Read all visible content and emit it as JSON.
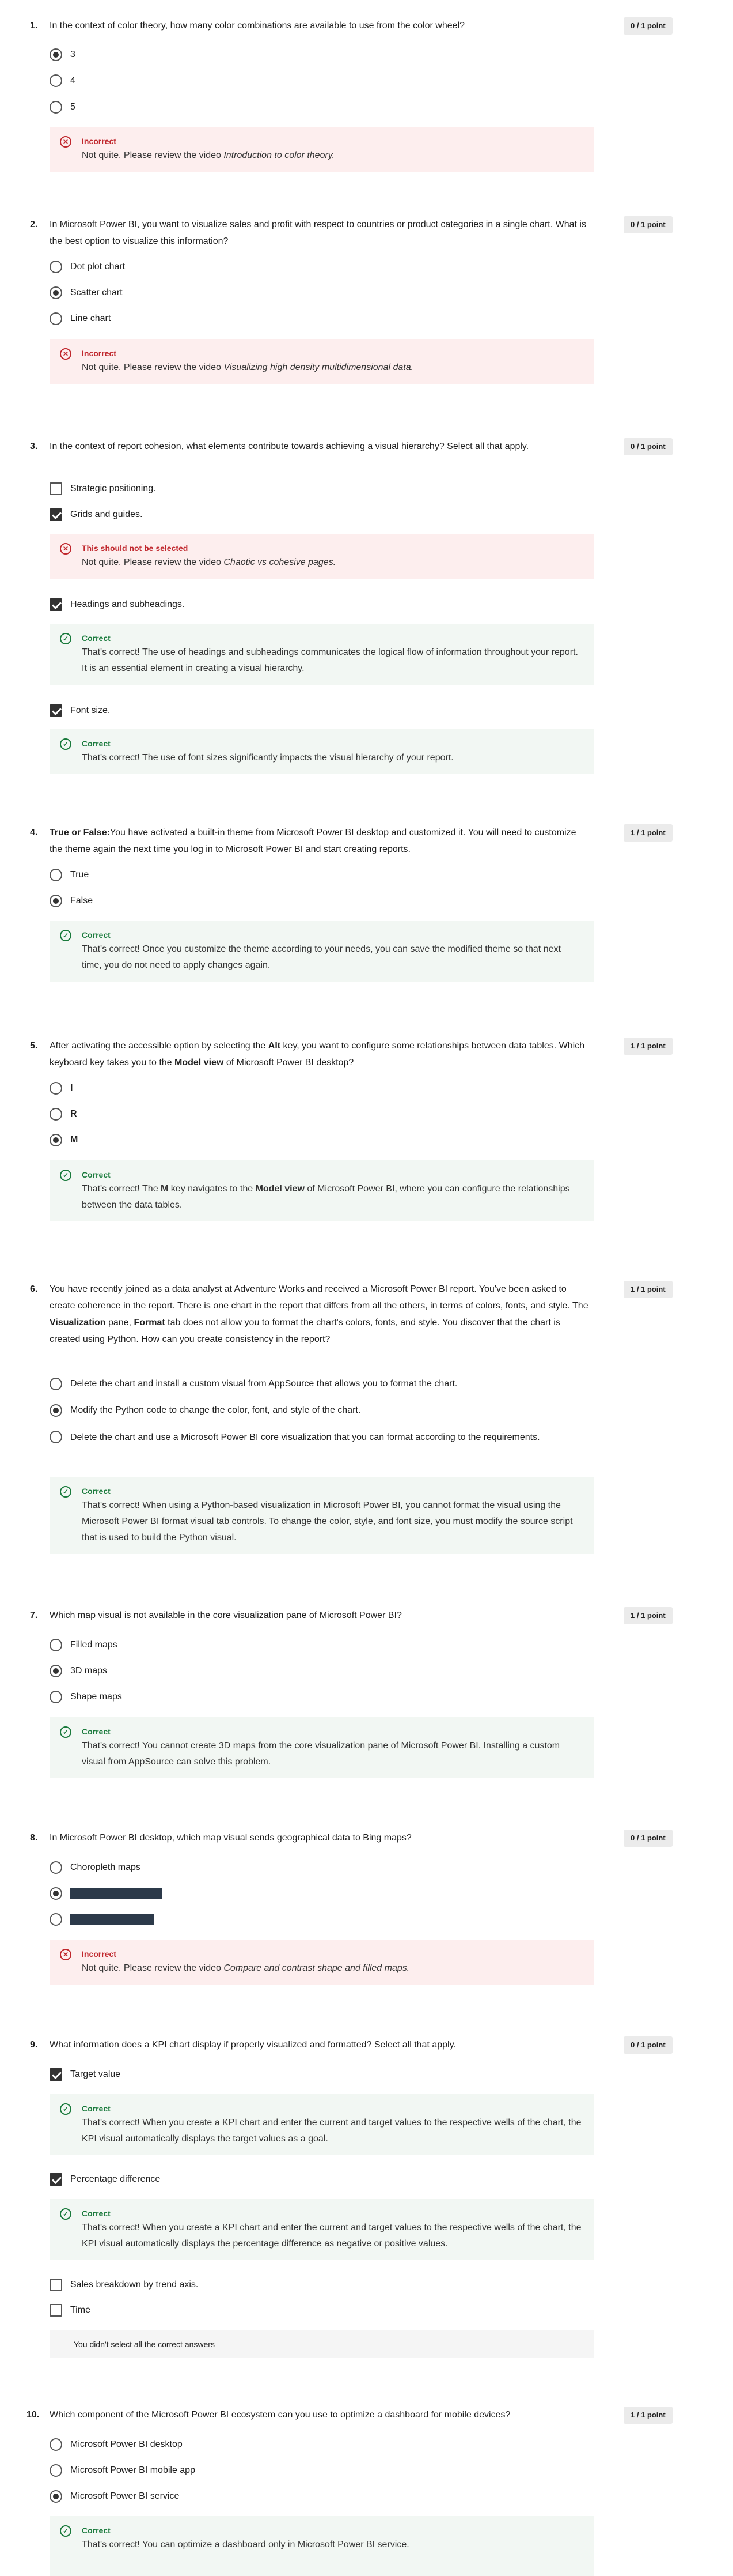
{
  "questions": [
    {
      "num": "1.",
      "text": "In the context of color theory, how many color combinations are available to use from the color wheel?",
      "score": "0 / 1 point",
      "options": [
        "3",
        "4",
        "5"
      ],
      "feedback": [
        {
          "title": "Incorrect",
          "msg_pre": "Not quite. Please review the video ",
          "msg_em": "Introduction to color theory."
        }
      ]
    },
    {
      "num": "2.",
      "text": "In Microsoft Power BI, you want to visualize sales and profit with respect to countries or product categories in a single chart. What is the best option to visualize this information?",
      "score": "0 / 1 point",
      "options": [
        "Dot plot chart",
        "Scatter chart",
        "Line chart"
      ],
      "feedback": [
        {
          "title": "Incorrect",
          "msg_pre": "Not quite. Please review the video ",
          "msg_em": "Visualizing high density multidimensional data."
        }
      ]
    },
    {
      "num": "3.",
      "text": "In the context of report cohesion, what elements contribute towards achieving a visual hierarchy? Select all that apply.",
      "score": "0 / 1 point",
      "options": [
        "Strategic positioning.",
        "Grids and guides.",
        "Headings and subheadings.",
        "Font size."
      ],
      "feedback": [
        {
          "title": "This should not be selected",
          "msg_pre": "Not quite. Please review the video ",
          "msg_em": "Chaotic vs cohesive pages."
        },
        {
          "title": "Correct",
          "msg": "That's correct! The use of headings and subheadings communicates the logical flow of information throughout your report. It is an essential element in creating a visual hierarchy."
        },
        {
          "title": "Correct",
          "msg": "That's correct! The use of font sizes significantly impacts the visual hierarchy of your report."
        }
      ]
    },
    {
      "num": "4.",
      "text_bold": "True or False:",
      "text": "You have activated a built-in theme from Microsoft Power BI desktop and customized it. You will need to customize the theme again the next time you log in to Microsoft Power BI and start creating reports.",
      "score": "1 / 1 point",
      "options": [
        "True",
        "False"
      ],
      "feedback": [
        {
          "title": "Correct",
          "msg": "That's correct! Once you customize the theme according to your needs, you can save the modified theme so that next time, you do not need to apply changes again."
        }
      ]
    },
    {
      "num": "5.",
      "text_a": "After activating the accessible option by selecting the ",
      "text_b1": "Alt",
      "text_c": " key, you want to configure some relationships between data tables. Which keyboard key takes you to the ",
      "text_b2": "Model view",
      "text_d": " of Microsoft Power BI desktop?",
      "score": "1 / 1 point",
      "options": [
        "I",
        "R",
        "M"
      ],
      "feedback": [
        {
          "title": "Correct",
          "msg_a": "That's correct! The ",
          "msg_b1": "M",
          "msg_c": " key navigates to the ",
          "msg_b2": "Model view",
          "msg_d": " of Microsoft Power BI, where you can configure the relationships between the data tables."
        }
      ]
    },
    {
      "num": "6.",
      "text_a": "You have recently joined as a data analyst at Adventure Works and received a Microsoft Power BI report. You've been asked to create coherence in the report. There is one chart in the report that differs from all the others, in terms of colors, fonts, and style. The ",
      "text_b1": "Visualization",
      "text_c": " pane, ",
      "text_b2": "Format",
      "text_d": " tab does not allow you to format the chart's colors, fonts, and style. You discover that the chart is created using Python. How can you create consistency in the report?",
      "score": "1 / 1 point",
      "options": [
        "Delete the chart and install a custom visual from AppSource that allows you to format the chart.",
        "Modify the Python code to change the color, font, and style of the chart.",
        "Delete the chart and use a Microsoft Power BI core visualization that you can format according to the requirements."
      ],
      "feedback": [
        {
          "title": "Correct",
          "msg": "That's correct! When using a Python-based visualization in Microsoft Power BI, you cannot format the visual using the Microsoft Power BI format visual tab controls. To change the color, style, and font size, you must modify the source script that is used to build the Python visual."
        }
      ]
    },
    {
      "num": "7.",
      "text": "Which map visual is not available in the core visualization pane of Microsoft Power BI?",
      "score": "1 / 1 point",
      "options": [
        "Filled maps",
        "3D maps",
        "Shape maps"
      ],
      "feedback": [
        {
          "title": "Correct",
          "msg": "That's correct! You cannot create 3D maps from the core visualization pane of Microsoft Power BI. Installing a custom visual from AppSource can solve this problem."
        }
      ]
    },
    {
      "num": "8.",
      "text": "In Microsoft Power BI desktop, which map visual sends geographical data to Bing maps?",
      "score": "0 / 1 point",
      "options": [
        "Choropleth maps"
      ],
      "feedback": [
        {
          "title": "Incorrect",
          "msg_pre": "Not quite. Please review the video ",
          "msg_em": "Compare and contrast shape and filled maps."
        }
      ]
    },
    {
      "num": "9.",
      "text": "What information does a KPI chart display if properly visualized and formatted? Select all that apply.",
      "score": "0 / 1 point",
      "options": [
        "Target value",
        "Percentage difference",
        "Sales breakdown by trend axis.",
        "Time"
      ],
      "feedback": [
        {
          "title": "Correct",
          "msg": "That's correct! When you create a KPI chart and enter the current and target values to the respective wells of the chart, the KPI visual automatically displays the target values as a goal."
        },
        {
          "title": "Correct",
          "msg": "That's correct! When you create a KPI chart and enter the current and target values to the respective wells of the chart, the KPI visual automatically displays the percentage difference as negative or positive values."
        }
      ],
      "note": "You didn't select all the correct answers"
    },
    {
      "num": "10.",
      "text": "Which component of the Microsoft Power BI ecosystem can you use to optimize a dashboard for mobile devices?",
      "score": "1 / 1 point",
      "options": [
        "Microsoft Power BI desktop",
        "Microsoft Power BI mobile app",
        "Microsoft Power BI service"
      ],
      "feedback": [
        {
          "title": "Correct",
          "msg": "That's correct! You can optimize a dashboard only in Microsoft Power BI service."
        }
      ]
    }
  ]
}
